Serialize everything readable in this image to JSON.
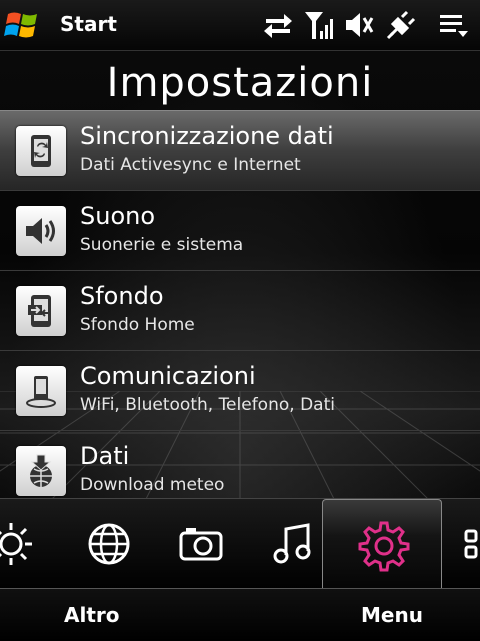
{
  "statusbar": {
    "start_label": "Start",
    "icons": [
      "sync-arrows-icon",
      "signal-icon",
      "speaker-muted-icon",
      "plug-icon",
      "menu-icon"
    ]
  },
  "page": {
    "title": "Impostazioni"
  },
  "settings": [
    {
      "title": "Sincronizzazione dati",
      "subtitle": "Dati Activesync e Internet",
      "icon": "sync-phone-icon",
      "selected": true
    },
    {
      "title": "Suono",
      "subtitle": "Suonerie e sistema",
      "icon": "speaker-icon",
      "selected": false
    },
    {
      "title": "Sfondo",
      "subtitle": "Sfondo Home",
      "icon": "wallpaper-icon",
      "selected": false
    },
    {
      "title": "Comunicazioni",
      "subtitle": "WiFi, Bluetooth, Telefono, Dati",
      "icon": "phone-wireless-icon",
      "selected": false
    },
    {
      "title": "Dati",
      "subtitle": "Download meteo",
      "icon": "download-globe-icon",
      "selected": false
    }
  ],
  "tabs": [
    "sun-icon",
    "globe-icon",
    "camera-icon",
    "music-icon",
    "gear-icon",
    "apps-icon"
  ],
  "active_tab": "gear-icon",
  "softkeys": {
    "left": "Altro",
    "right": "Menu"
  },
  "colors": {
    "accent": "#e0308a",
    "background": "#000000"
  }
}
